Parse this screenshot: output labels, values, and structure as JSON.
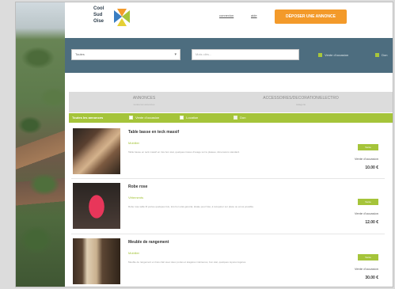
{
  "header": {
    "logo_text": "Cool Sud Oise",
    "nav_link_1": "connexion",
    "nav_link_2": "aide",
    "cta_label": "DÉPOSER UNE ANNONCE"
  },
  "search": {
    "category_value": "Toutes",
    "keyword_placeholder": "Mots clés...",
    "option_1": "Vente d'occasion",
    "option_2": "Don"
  },
  "tabs": [
    {
      "label": "ANNONCES",
      "sub": "toutes les annonces"
    },
    {
      "label": "ACCESSOIRES/DECORATION/ELECTRO",
      "sub": "catégorie"
    }
  ],
  "filters": {
    "title": "Toutes les annonces",
    "options": [
      "Vente d'occasion",
      "Location",
      "Don"
    ]
  },
  "listings": [
    {
      "title": "Table basse en teck massif",
      "subtitle": "Mobilier",
      "description": "Table basse en teck massif en très bon état, quelques traces d'usage sur le plateau, dimensions standard.",
      "badge": "Vente",
      "kind": "Vente d'occasion",
      "price": "10.00 €"
    },
    {
      "title": "Robe rose",
      "subtitle": "Vêtements",
      "description": "Robe rose taille M portée quelques fois, très bon état général, idéale pour l'été, à récupérer sur place ou envoi possible.",
      "badge": "Vente",
      "kind": "Vente d'occasion",
      "price": "12.00 €"
    },
    {
      "title": "Meuble de rangement",
      "subtitle": "Mobilier",
      "description": "Meuble de rangement en bois clair avec deux portes et étagères intérieures, bon état, quelques rayures légères.",
      "badge": "Vente",
      "kind": "Vente d'occasion",
      "price": "30.00 €"
    }
  ]
}
